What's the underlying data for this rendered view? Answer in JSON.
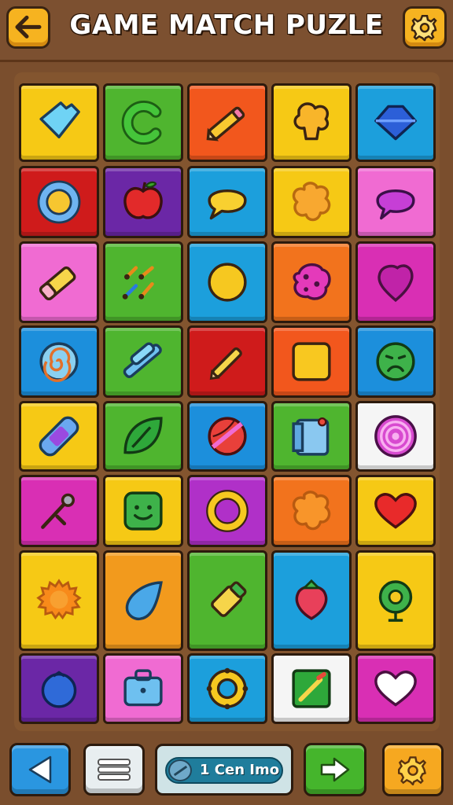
{
  "header": {
    "title": "GAME MATCH PUZLE",
    "back_icon": "arrow-left-icon",
    "settings_icon": "gear-icon"
  },
  "board": {
    "rows": 8,
    "columns": 5,
    "tiles": [
      [
        {
          "color": "#f6c915",
          "icon": "blue-gem-icon"
        },
        {
          "color": "#4fb52f",
          "icon": "letter-c-icon"
        },
        {
          "color": "#f2571d",
          "icon": "pencil-icon"
        },
        {
          "color": "#f6c915",
          "icon": "yellow-blob-icon"
        },
        {
          "color": "#1c9fdc",
          "icon": "blue-diamond-icon"
        }
      ],
      [
        {
          "color": "#cf1b1b",
          "icon": "ring-icon"
        },
        {
          "color": "#6b27a6",
          "icon": "apple-icon"
        },
        {
          "color": "#1c9fdc",
          "icon": "speech-bubble-icon"
        },
        {
          "color": "#f6c915",
          "icon": "flower-blob-icon"
        },
        {
          "color": "#f06bd2",
          "icon": "purple-bubble-icon"
        }
      ],
      [
        {
          "color": "#f06bd2",
          "icon": "eraser-pencil-icon"
        },
        {
          "color": "#4fb52f",
          "icon": "music-notes-icon"
        },
        {
          "color": "#1c9fdc",
          "icon": "yellow-circle-icon"
        },
        {
          "color": "#f2731d",
          "icon": "pink-cookie-icon"
        },
        {
          "color": "#d92fb4",
          "icon": "pink-drop-icon"
        }
      ],
      [
        {
          "color": "#1c8fdc",
          "icon": "spiral-icon"
        },
        {
          "color": "#4fb52f",
          "icon": "crossed-sticks-icon"
        },
        {
          "color": "#cf1b1b",
          "icon": "small-pencil-icon"
        },
        {
          "color": "#f2571d",
          "icon": "yellow-square-icon"
        },
        {
          "color": "#1c8fdc",
          "icon": "sad-face-icon"
        }
      ],
      [
        {
          "color": "#f6c915",
          "icon": "bandage-icon"
        },
        {
          "color": "#4fb52f",
          "icon": "leaf-icon"
        },
        {
          "color": "#1c8fdc",
          "icon": "striped-ball-icon"
        },
        {
          "color": "#4fb52f",
          "icon": "notebook-icon"
        },
        {
          "color": "#f5f5f5",
          "icon": "purple-spiral-icon"
        }
      ],
      [
        {
          "color": "#d92fb4",
          "icon": "pin-icon"
        },
        {
          "color": "#f6c915",
          "icon": "smiley-block-icon"
        },
        {
          "color": "#b030c8",
          "icon": "yellow-ring-icon"
        },
        {
          "color": "#f2731d",
          "icon": "orange-blob-icon"
        },
        {
          "color": "#f6c915",
          "icon": "heart-icon"
        }
      ],
      [
        {
          "color": "#f6c915",
          "icon": "sun-gear-icon"
        },
        {
          "color": "#f29a1d",
          "icon": "water-drop-icon"
        },
        {
          "color": "#4fb52f",
          "icon": "glue-stick-icon"
        },
        {
          "color": "#1c9fdc",
          "icon": "strawberry-icon"
        },
        {
          "color": "#f6c915",
          "icon": "green-plant-icon"
        }
      ],
      [
        {
          "color": "#6b27a6",
          "icon": "blue-berry-icon"
        },
        {
          "color": "#f06bd2",
          "icon": "briefcase-icon"
        },
        {
          "color": "#1c9fdc",
          "icon": "yellow-gear-ring-icon"
        },
        {
          "color": "#f5f5f5",
          "icon": "green-note-icon"
        },
        {
          "color": "#d92fb4",
          "icon": "white-heart-icon"
        }
      ]
    ]
  },
  "footer": {
    "prev_icon": "play-left-icon",
    "menu_icon": "menu-lines-icon",
    "counter_text": "1 Cen Imo",
    "next_icon": "arrow-right-icon",
    "settings_icon": "gear-icon"
  }
}
